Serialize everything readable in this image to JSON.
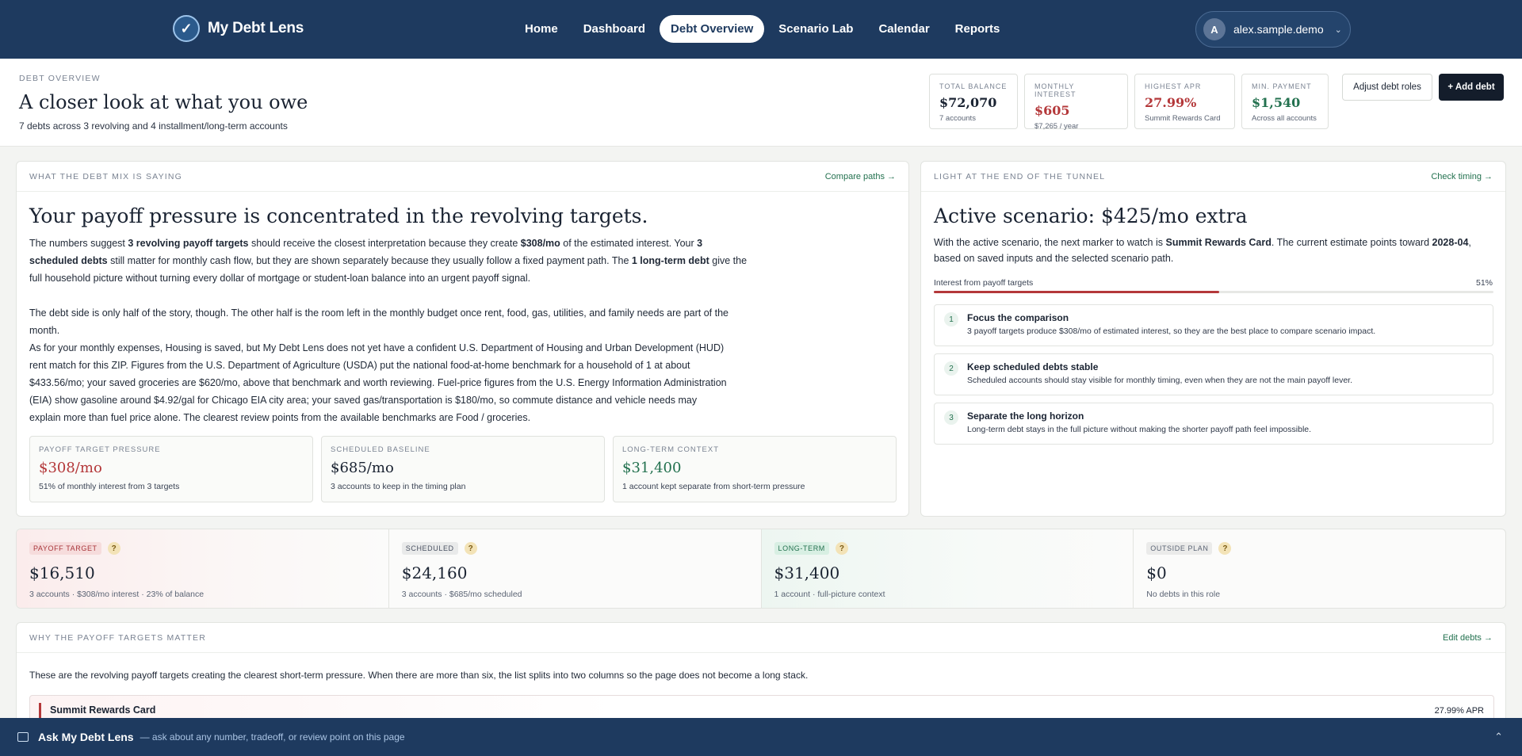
{
  "nav": {
    "brand": "My Debt Lens",
    "links": [
      "Home",
      "Dashboard",
      "Debt Overview",
      "Scenario Lab",
      "Calendar",
      "Reports"
    ],
    "active": "Debt Overview",
    "user": {
      "initial": "A",
      "name": "alex.sample.demo"
    }
  },
  "header": {
    "eyebrow": "DEBT OVERVIEW",
    "title": "A closer look at what you owe",
    "subtitle": "7 debts across 3 revolving and 4 installment/long-term accounts",
    "stats": [
      {
        "label": "TOTAL BALANCE",
        "value": "$72,070",
        "sub": "7 accounts",
        "color": "#1a2332"
      },
      {
        "label": "MONTHLY INTEREST",
        "value": "$605",
        "sub": "$7,265 / year",
        "color": "#b4383a"
      },
      {
        "label": "HIGHEST APR",
        "value": "27.99%",
        "sub": "Summit Rewards Card",
        "color": "#b4383a"
      },
      {
        "label": "MIN. PAYMENT",
        "value": "$1,540",
        "sub": "Across all accounts",
        "color": "#23714f"
      }
    ],
    "adjust_label": "Adjust debt roles",
    "add_label": "+ Add debt"
  },
  "mix": {
    "eyebrow": "WHAT THE DEBT MIX IS SAYING",
    "link": "Compare paths →",
    "title": "Your payoff pressure is concentrated in the revolving targets.",
    "p1": [
      "The numbers suggest ",
      "3 revolving payoff targets",
      " should receive the closest interpretation because they create ",
      "$308/mo",
      " of the estimated interest. Your ",
      "3 scheduled debts",
      " still matter for monthly cash flow, but they are shown separately because they usually follow a fixed payment path. The ",
      "1 long-term debt",
      " give the full household picture without turning every dollar of mortgage or student-loan balance into an urgent payoff signal."
    ],
    "p2": "The debt side is only half of the story, though. The other half is the room left in the monthly budget once rent, food, gas, utilities, and family needs are part of the month.",
    "p3": "As for your monthly expenses, Housing is saved, but My Debt Lens does not yet have a confident U.S. Department of Housing and Urban Development (HUD) rent match for this ZIP. Figures from the U.S. Department of Agriculture (USDA) put the national food-at-home benchmark for a household of 1 at about $433.56/mo; your saved groceries are $620/mo, above that benchmark and worth reviewing. Fuel-price figures from the U.S. Energy Information Administration (EIA) show gasoline around $4.92/gal for Chicago EIA city area; your saved gas/transportation is $180/mo, so commute distance and vehicle needs may explain more than fuel price alone. The clearest review points from the available benchmarks are Food / groceries.",
    "cards": [
      {
        "label": "PAYOFF TARGET PRESSURE",
        "value": "$308/mo",
        "sub": "51% of monthly interest from 3 targets",
        "color": "#b4383a"
      },
      {
        "label": "SCHEDULED BASELINE",
        "value": "$685/mo",
        "sub": "3 accounts to keep in the timing plan",
        "color": "#1a2332"
      },
      {
        "label": "LONG-TERM CONTEXT",
        "value": "$31,400",
        "sub": "1 account kept separate from short-term pressure",
        "color": "#23714f"
      }
    ]
  },
  "tunnel": {
    "eyebrow": "LIGHT AT THE END OF THE TUNNEL",
    "link": "Check timing →",
    "title": "Active scenario: $425/mo extra",
    "desc": [
      "With the active scenario, the next marker to watch is ",
      "Summit Rewards Card",
      ". The current estimate points toward ",
      "2028-04",
      ", based on saved inputs and the selected scenario path."
    ],
    "progress_label": "Interest from payoff targets",
    "progress_value": "51%",
    "progress_fraction": 0.51,
    "steps": [
      {
        "num": "1",
        "title": "Focus the comparison",
        "desc": "3 payoff targets produce $308/mo of estimated interest, so they are the best place to compare scenario impact."
      },
      {
        "num": "2",
        "title": "Keep scheduled debts stable",
        "desc": "Scheduled accounts should stay visible for monthly timing, even when they are not the main payoff lever."
      },
      {
        "num": "3",
        "title": "Separate the long horizon",
        "desc": "Long-term debt stays in the full picture without making the shorter payoff path feel impossible."
      }
    ]
  },
  "roles": [
    {
      "tag": "PAYOFF TARGET",
      "value": "$16,510",
      "sub": "3 accounts · $308/mo interest · 23% of balance",
      "tag_bg": "#f6dcdc",
      "tag_color": "#a8353a"
    },
    {
      "tag": "SCHEDULED",
      "value": "$24,160",
      "sub": "3 accounts · $685/mo scheduled",
      "tag_bg": "#e9eaea",
      "tag_color": "#4a5262"
    },
    {
      "tag": "LONG-TERM",
      "value": "$31,400",
      "sub": "1 account · full-picture context",
      "tag_bg": "#d8efe3",
      "tag_color": "#23714f"
    },
    {
      "tag": "OUTSIDE PLAN",
      "value": "$0",
      "sub": "No debts in this role",
      "tag_bg": "#ebebea",
      "tag_color": "#5b6474"
    }
  ],
  "why": {
    "eyebrow": "WHY THE PAYOFF TARGETS MATTER",
    "link": "Edit debts →",
    "intro": "These are the revolving payoff targets creating the clearest short-term pressure. When there are more than six, the list splits into two columns so the page does not become a long stack.",
    "first_name": "Summit Rewards Card",
    "first_apr": "27.99% APR"
  },
  "ask": {
    "title": "Ask My Debt Lens",
    "hint": "— ask about any number, tradeoff, or review point on this page"
  }
}
